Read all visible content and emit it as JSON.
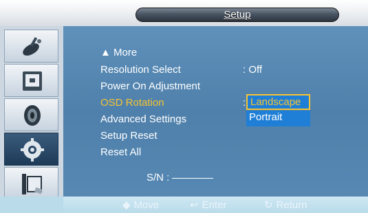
{
  "header": {
    "title": "Setup"
  },
  "sidebar": {
    "items": [
      {
        "icon": "picture-icon",
        "active": false
      },
      {
        "icon": "monitor-icon",
        "active": false
      },
      {
        "icon": "speaker-icon",
        "active": false
      },
      {
        "icon": "gear-icon",
        "active": true
      },
      {
        "icon": "multi-screen-icon",
        "active": false
      }
    ]
  },
  "menu": {
    "more_label": "▲ More",
    "items": [
      {
        "label": "Resolution Select",
        "value": ": Off"
      },
      {
        "label": "Power On Adjustment",
        "value": ""
      },
      {
        "label": "OSD Rotation",
        "value": ":",
        "selected": true
      },
      {
        "label": "Advanced Settings",
        "value": ""
      },
      {
        "label": "Setup Reset",
        "value": ""
      },
      {
        "label": "Reset All",
        "value": ""
      }
    ],
    "dropdown": {
      "options": [
        "Landscape",
        "Portrait"
      ],
      "highlighted": "Landscape"
    },
    "serial": {
      "label": "S/N :"
    }
  },
  "footer": {
    "move": {
      "icon": "up-down-icon",
      "label": "Move"
    },
    "enter": {
      "icon": "enter-icon",
      "label": "Enter"
    },
    "return": {
      "icon": "return-icon",
      "label": "Return"
    }
  },
  "colors": {
    "panel": "#5486b1",
    "highlight": "#f6c433",
    "dropdown": "#1f7fd6"
  }
}
